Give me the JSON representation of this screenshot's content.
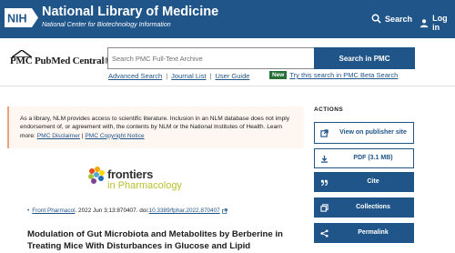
{
  "header": {
    "logo_text": "NIH",
    "title": "National Library of Medicine",
    "subtitle": "National Center for Biotechnology Information",
    "search_label": "Search",
    "login_label": "Log in"
  },
  "pmc": {
    "logo_text": "PMC PubMed Central®",
    "search_placeholder": "Search PMC Full-Text Archive",
    "search_button": "Search in PMC",
    "links": [
      "Advanced Search",
      "Journal List",
      "User Guide"
    ],
    "new_badge": "New",
    "beta_link": "Try this search in PMC Beta Search"
  },
  "disclaimer": {
    "text": "As a library, NLM provides access to scientific literature. Inclusion in an NLM database does not imply endorsement of, or agreement with, the contents by NLM or the National Institutes of Health.",
    "learn_more": "Learn more:",
    "link1": "PMC Disclaimer",
    "sep": "|",
    "link2": "PMC Copyright Notice"
  },
  "journal": {
    "name": "frontiers",
    "subname": "in Pharmacology"
  },
  "citation": {
    "journal_link": "Front Pharmacol",
    "details": ". 2022 Jun 3;13:870407. doi: ",
    "doi": "10.3389/fphar.2022.870407"
  },
  "article": {
    "title": "Modulation of Gut Microbiota and Metabolites by Berberine in Treating Mice With Disturbances in Glucose and Lipid Metabolism"
  },
  "actions": {
    "heading": "ACTIONS",
    "buttons": [
      {
        "label": "View on publisher site",
        "icon": "external-link-icon"
      },
      {
        "label": "PDF (3.1 MB)",
        "icon": "download-icon"
      },
      {
        "label": "Cite",
        "icon": "quote-icon"
      },
      {
        "label": "Collections",
        "icon": "collections-icon"
      },
      {
        "label": "Permalink",
        "icon": "share-icon"
      }
    ]
  },
  "colors": {
    "primary": "#20558a",
    "new_badge": "#266f37",
    "disclaimer_bg": "#fdf6f1",
    "frontiers_green": "#b9c02e"
  }
}
